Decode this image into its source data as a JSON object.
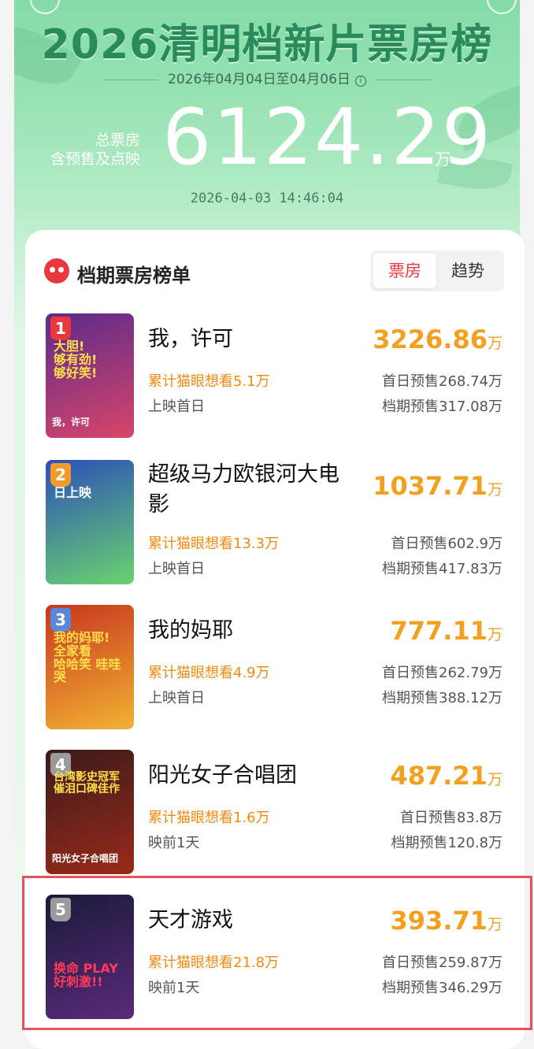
{
  "header": {
    "title": "2026清明档新片票房榜",
    "date_range": "2026年04月04日至04月06日",
    "info_icon": "i",
    "total_label_1": "总票房",
    "total_label_2": "含预售及点映",
    "total_value": "6124.29",
    "total_unit": "万",
    "timestamp": "2026-04-03  14:46:04"
  },
  "card": {
    "title": "档期票房榜单",
    "tabs": [
      "票房",
      "趋势"
    ],
    "active_tab": "票房"
  },
  "movies": [
    {
      "rank": "1",
      "name": "我，许可",
      "want": "累计猫眼想看5.1万",
      "status": "上映首日",
      "box": "3226.86",
      "unit": "万",
      "first_presale": "首日预售268.74万",
      "period_presale": "档期预售317.08万",
      "poster_text": "大胆!\n够有劲!\n够好笑!",
      "poster_sub": "我，许可",
      "colors": {
        "rank": "#e8383d",
        "poster_a": "#5b2a8a",
        "poster_b": "#d8456a"
      }
    },
    {
      "rank": "2",
      "name": "超级马力欧银河大电影",
      "want": "累计猫眼想看13.3万",
      "status": "上映首日",
      "box": "1037.71",
      "unit": "万",
      "first_presale": "首日预售602.9万",
      "period_presale": "档期预售417.83万",
      "poster_text": "日上映",
      "poster_sub": "",
      "colors": {
        "rank": "#f39a2a",
        "poster_a": "#2a4fb8",
        "poster_b": "#6ad36f"
      }
    },
    {
      "rank": "3",
      "name": "我的妈耶",
      "want": "累计猫眼想看4.9万",
      "status": "上映首日",
      "box": "777.11",
      "unit": "万",
      "first_presale": "首日预售262.79万",
      "period_presale": "档期预售388.12万",
      "poster_text": "我的妈耶!\n全家看\n哈哈笑 哇哇哭",
      "poster_sub": "",
      "colors": {
        "rank": "#5a88d6",
        "poster_a": "#c7361f",
        "poster_b": "#f2b233"
      }
    },
    {
      "rank": "4",
      "name": "阳光女子合唱团",
      "want": "累计猫眼想看1.6万",
      "status": "映前1天",
      "box": "487.21",
      "unit": "万",
      "first_presale": "首日预售83.8万",
      "period_presale": "档期预售120.8万",
      "poster_text": "台湾影史冠军\n催泪口碑佳作",
      "poster_sub": "阳光女子合唱团",
      "colors": {
        "rank": "#9a9a9a",
        "poster_a": "#3a1a1a",
        "poster_b": "#9a2a1a"
      }
    },
    {
      "rank": "5",
      "name": "天才游戏",
      "want": "累计猫眼想看21.8万",
      "status": "映前1天",
      "box": "393.71",
      "unit": "万",
      "first_presale": "首日预售259.87万",
      "period_presale": "档期预售346.29万",
      "poster_text": "换命 PLAY\n好刺激!!",
      "poster_sub": "",
      "colors": {
        "rank": "#9a9a9a",
        "poster_a": "#1a1a3a",
        "poster_b": "#5a2a7a"
      }
    }
  ]
}
